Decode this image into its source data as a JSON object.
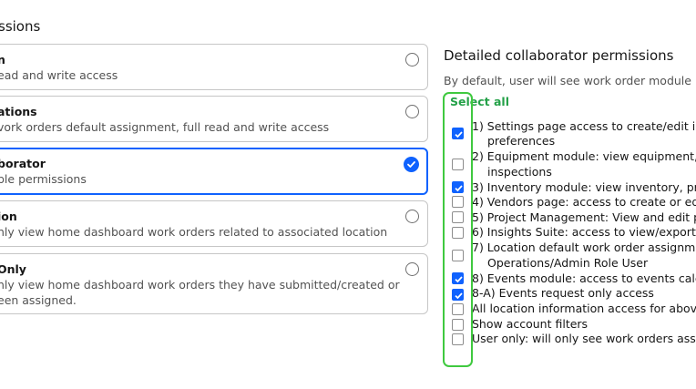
{
  "page": {
    "permissions_title": "ssions",
    "detailed_title": "Detailed collaborator permissions",
    "detailed_subtitle": "By default, user will see work order module (",
    "select_all": "Select all"
  },
  "roles": [
    {
      "title": "n",
      "description": "ead and write access",
      "selected": false
    },
    {
      "title": "ations",
      "description": "vork orders default assignment, full read and write access",
      "selected": false
    },
    {
      "title": "borator",
      "description": "ble permissions",
      "selected": true
    },
    {
      "title": "ion",
      "description": "nly view home dashboard work orders related to associated location",
      "selected": false
    },
    {
      "title": "Only",
      "description_line1": "nly view home dashboard work orders they have submitted/created or",
      "description_line2": "een assigned.",
      "selected": false
    }
  ],
  "permissions": [
    {
      "line1": "1) Settings page access to create/edit in",
      "line2": "preferences",
      "checked": true
    },
    {
      "line1": "2) Equipment module: view equipment,",
      "line2": "inspections",
      "checked": false
    },
    {
      "line1": "3) Inventory module: view inventory, pr",
      "checked": true
    },
    {
      "line1": "4) Vendors page: access to create or ed",
      "checked": false
    },
    {
      "line1": "5) Project Management: View and edit p",
      "checked": false
    },
    {
      "line1": "6) Insights Suite: access to view/export",
      "checked": false
    },
    {
      "line1": "7) Location default work order assignm",
      "line2": "Operations/Admin Role User",
      "checked": false
    },
    {
      "line1": "8) Events module: access to events cale",
      "checked": true
    },
    {
      "line1": "8-A) Events request only access",
      "checked": true
    },
    {
      "line1": "All location information access for abov",
      "checked": false
    },
    {
      "line1": "Show account filters",
      "checked": false
    },
    {
      "line1": "User only: will only see work orders ass",
      "checked": false
    }
  ],
  "colors": {
    "accent": "#0f62fe",
    "select_all_green": "#24a148",
    "highlight_green": "#3fc93f"
  }
}
